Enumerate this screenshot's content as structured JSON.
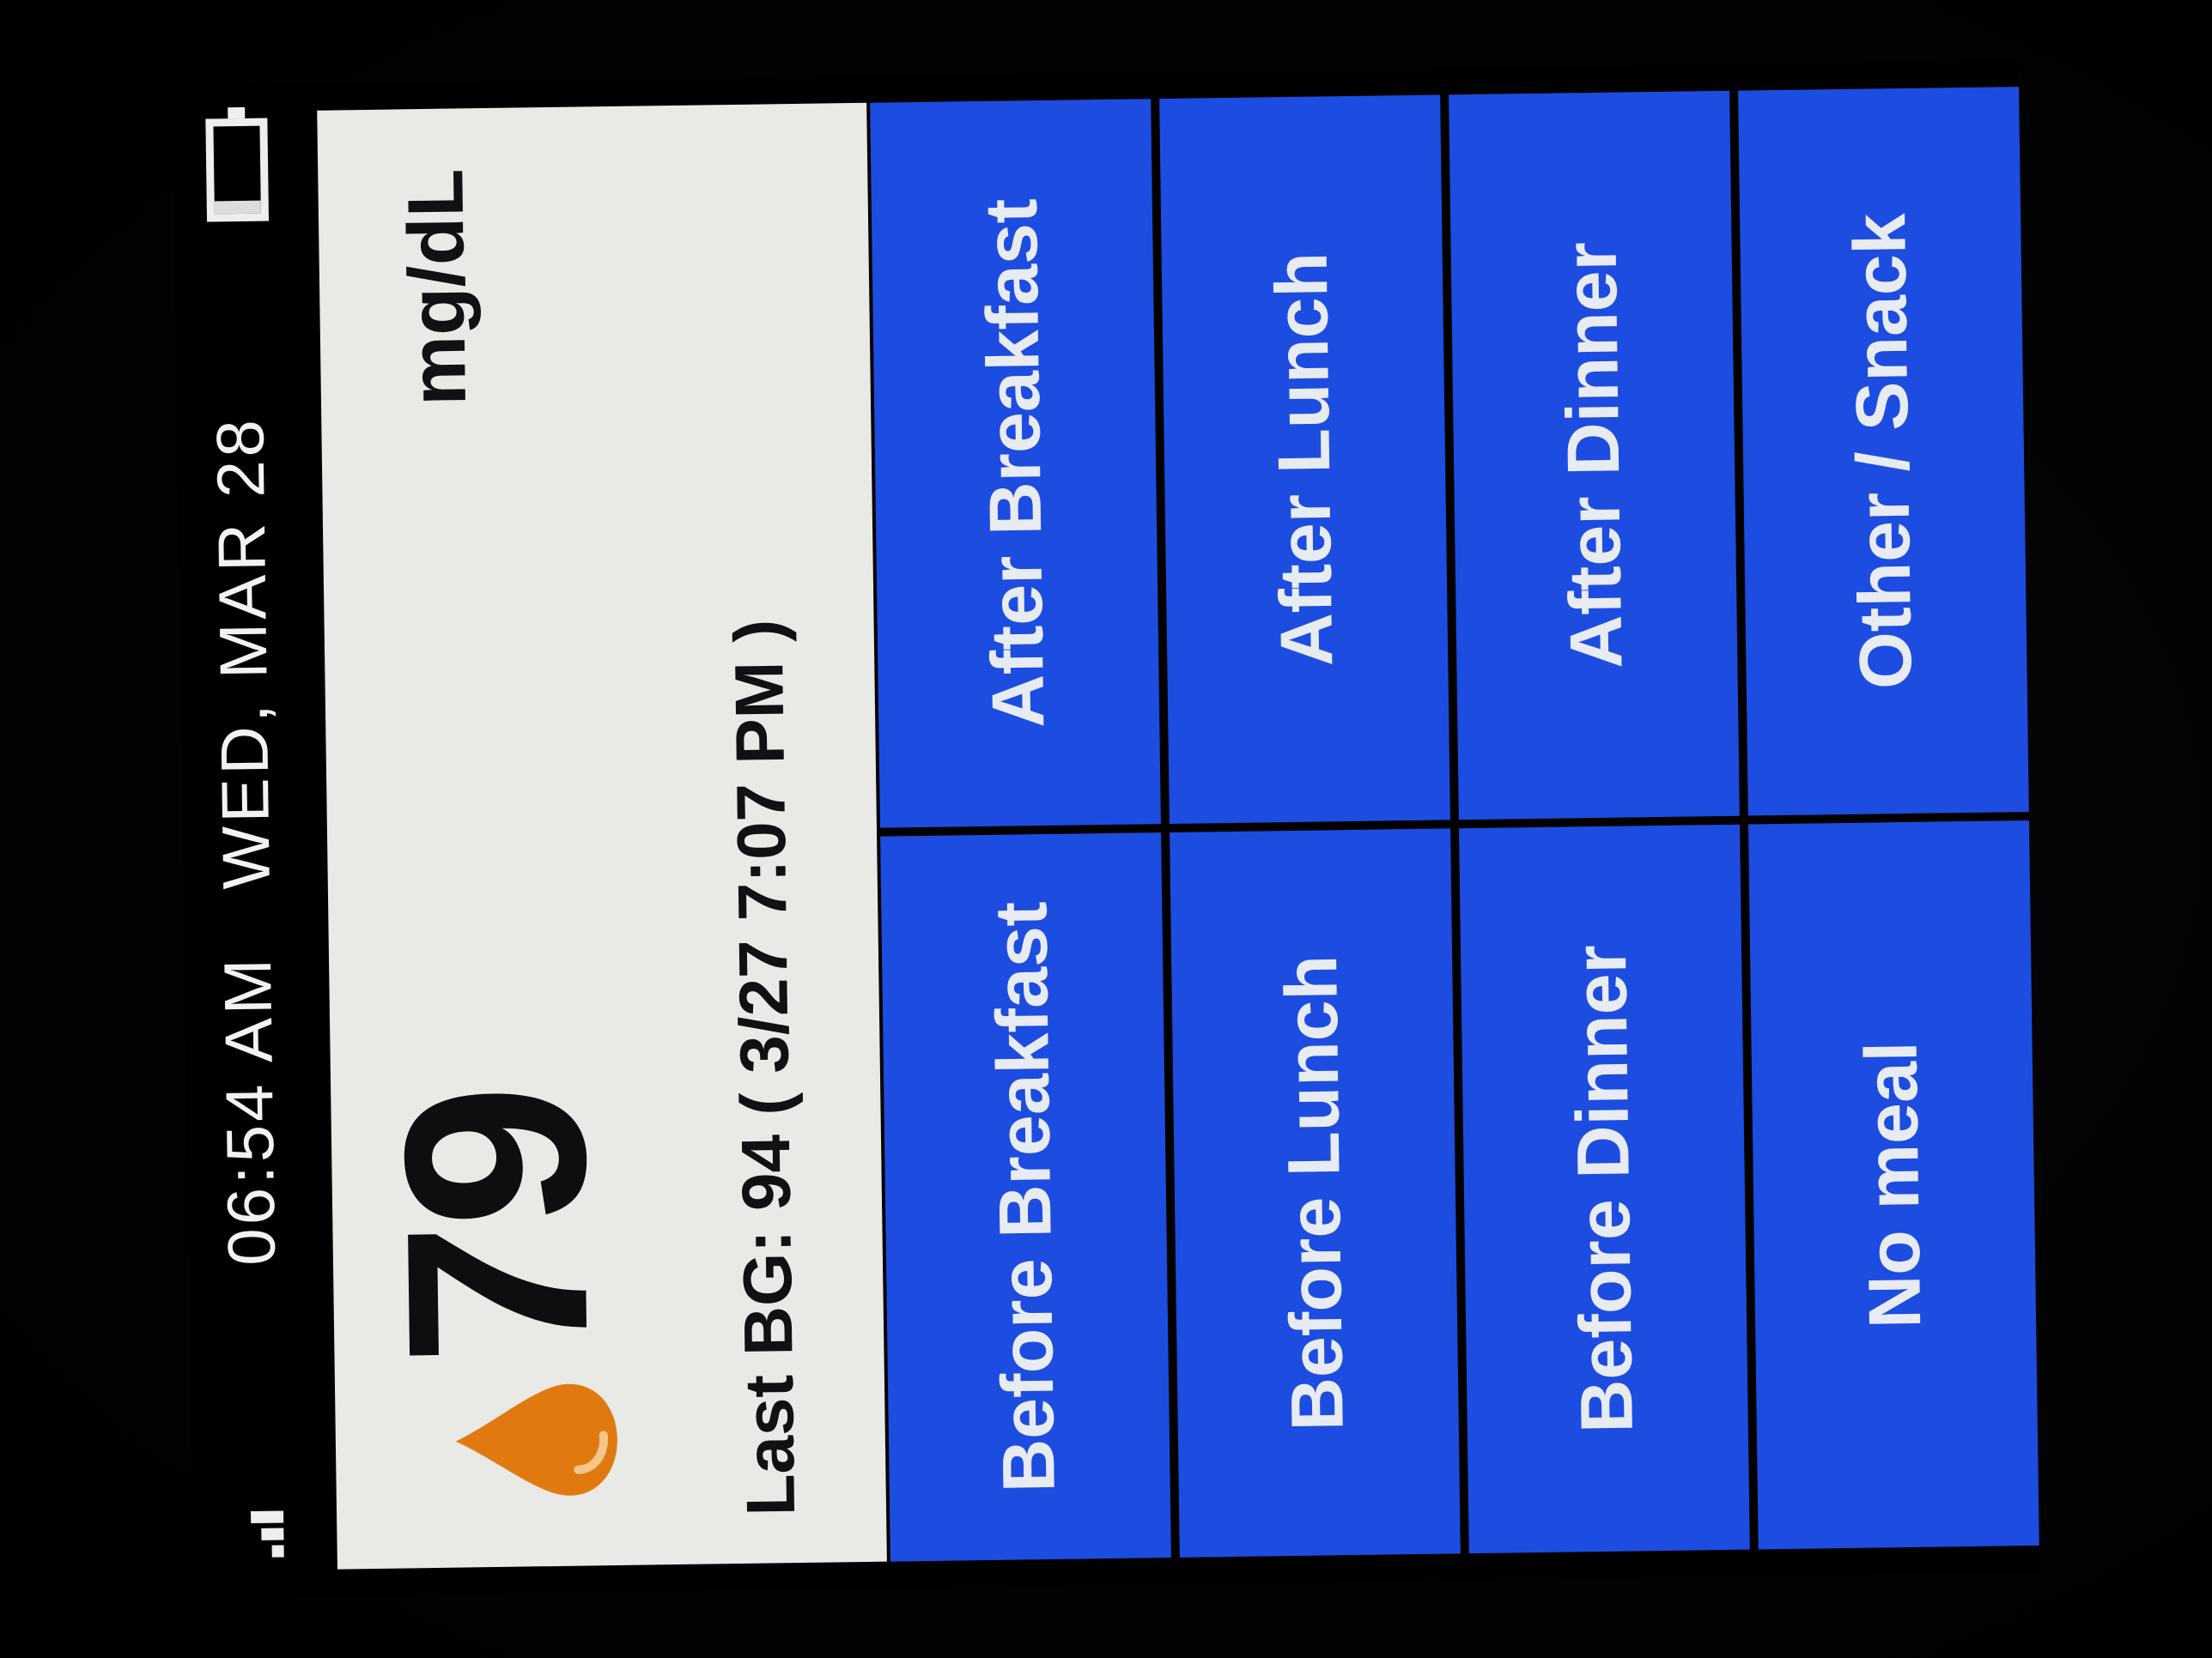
{
  "status_bar": {
    "time": "06:54 AM",
    "date": "WED, MAR 28",
    "signal_icon": "signal-bars-icon",
    "battery_icon": "battery-icon",
    "battery_level": 0.15
  },
  "reading": {
    "value": "79",
    "unit": "mg/dL",
    "drop_icon": "blood-drop-icon",
    "drop_color": "#e07a10",
    "last_bg": "Last BG: 94 ( 3/27  7:07 PM )"
  },
  "meal_buttons": [
    {
      "label": "Before Breakfast"
    },
    {
      "label": "After Breakfast"
    },
    {
      "label": "Before Lunch"
    },
    {
      "label": "After Lunch"
    },
    {
      "label": "Before Dinner"
    },
    {
      "label": "After Dinner"
    },
    {
      "label": "No meal"
    },
    {
      "label": "Other / Snack"
    }
  ],
  "colors": {
    "button_bg": "#1c4de0",
    "button_text": "#e8ecf2",
    "panel_bg": "#e9e9e6"
  }
}
